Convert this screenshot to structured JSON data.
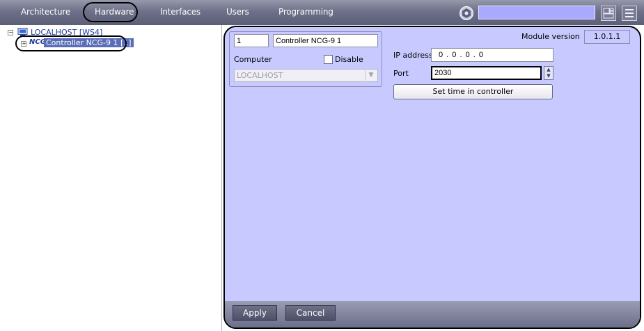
{
  "tabs": [
    {
      "label": "Architecture"
    },
    {
      "label": "Hardware"
    },
    {
      "label": "Interfaces"
    },
    {
      "label": "Users"
    },
    {
      "label": "Programming"
    }
  ],
  "active_tab": "Hardware",
  "search": {
    "value": ""
  },
  "tree": {
    "root": {
      "label": "LOCALHOST [WS4]",
      "expander": "−",
      "icon": "computer-icon"
    },
    "child": {
      "label": "Controller NCG-9 1 [1]",
      "expander": "+",
      "icon_text": "NCG",
      "selected": true
    }
  },
  "panel": {
    "id": "1",
    "name": "Controller NCG-9 1",
    "computer_label": "Computer",
    "disable_label": "Disable",
    "disable_checked": false,
    "computer_value": "LOCALHOST",
    "module_version_label": "Module version",
    "module_version": "1.0.1.1",
    "ip_label": "IP address",
    "ip_value": "0 . 0 . 0 . 0",
    "port_label": "Port",
    "port_value": "2030",
    "set_time_label": "Set time in controller"
  },
  "footer": {
    "apply_label": "Apply",
    "cancel_label": "Cancel"
  },
  "colors": {
    "accent": "#5b6db8",
    "panel_bg": "#c8caff",
    "topbar": "#6d7088"
  }
}
